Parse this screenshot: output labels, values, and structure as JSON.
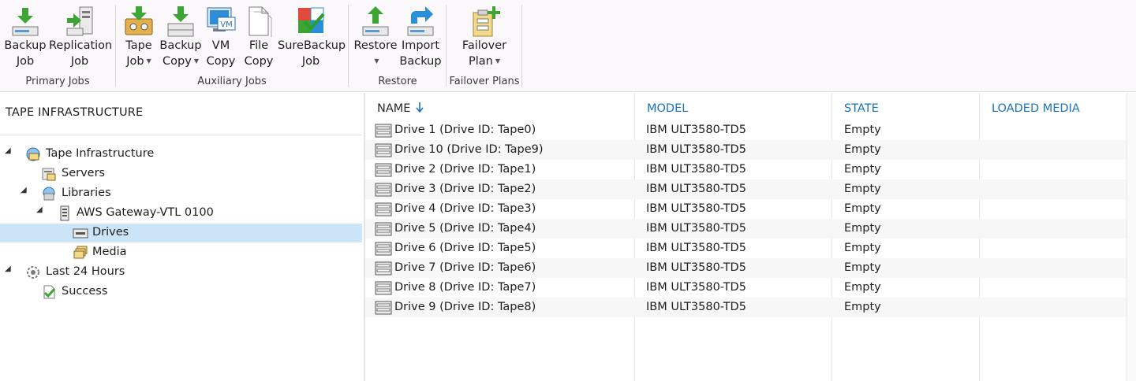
{
  "ribbon": {
    "groups": [
      {
        "caption": "Primary Jobs",
        "buttons": [
          {
            "line1": "Backup",
            "line2": "Job",
            "icon": "backup-job-icon"
          },
          {
            "line1": "Replication",
            "line2": "Job",
            "icon": "replication-job-icon"
          }
        ]
      },
      {
        "caption": "Auxiliary Jobs",
        "buttons": [
          {
            "line1": "Tape",
            "line2": "Job",
            "icon": "tape-job-icon",
            "dropdown": true
          },
          {
            "line1": "Backup",
            "line2": "Copy",
            "icon": "backup-copy-icon",
            "dropdown": true
          },
          {
            "line1": "VM",
            "line2": "Copy",
            "icon": "vm-copy-icon",
            "badge": "VM"
          },
          {
            "line1": "File",
            "line2": "Copy",
            "icon": "file-copy-icon"
          },
          {
            "line1": "SureBackup",
            "line2": "Job",
            "icon": "surebackup-job-icon"
          }
        ]
      },
      {
        "caption": "Restore",
        "buttons": [
          {
            "line1": "Restore",
            "line2": "",
            "icon": "restore-icon",
            "dropdown": true
          },
          {
            "line1": "Import",
            "line2": "Backup",
            "icon": "import-backup-icon"
          }
        ]
      },
      {
        "caption": "Failover Plans",
        "buttons": [
          {
            "line1": "Failover",
            "line2": "Plan",
            "icon": "failover-plan-icon",
            "dropdown": true
          }
        ]
      }
    ]
  },
  "tree": {
    "title": "TAPE INFRASTRUCTURE",
    "nodes": [
      {
        "label": "Tape Infrastructure",
        "icon": "tape-infrastructure-icon",
        "expanded": true
      },
      {
        "label": "Servers",
        "icon": "servers-icon"
      },
      {
        "label": "Libraries",
        "icon": "libraries-icon",
        "expanded": true
      },
      {
        "label": "AWS Gateway-VTL 0100",
        "icon": "tape-library-icon",
        "expanded": true
      },
      {
        "label": "Drives",
        "icon": "drives-icon",
        "selected": true
      },
      {
        "label": "Media",
        "icon": "media-icon"
      },
      {
        "label": "Last 24 Hours",
        "icon": "last-24-hours-icon",
        "expanded": true
      },
      {
        "label": "Success",
        "icon": "success-icon"
      }
    ]
  },
  "grid": {
    "columns": {
      "name": "NAME",
      "model": "MODEL",
      "state": "STATE",
      "loaded_media": "LOADED MEDIA"
    },
    "sort_icon": "sort-descending-icon",
    "rows": [
      {
        "name": "Drive 1 (Drive ID: Tape0)",
        "model": "IBM ULT3580-TD5",
        "state": "Empty",
        "loaded_media": ""
      },
      {
        "name": "Drive 10 (Drive ID: Tape9)",
        "model": "IBM ULT3580-TD5",
        "state": "Empty",
        "loaded_media": ""
      },
      {
        "name": "Drive 2 (Drive ID: Tape1)",
        "model": "IBM ULT3580-TD5",
        "state": "Empty",
        "loaded_media": ""
      },
      {
        "name": "Drive 3 (Drive ID: Tape2)",
        "model": "IBM ULT3580-TD5",
        "state": "Empty",
        "loaded_media": ""
      },
      {
        "name": "Drive 4 (Drive ID: Tape3)",
        "model": "IBM ULT3580-TD5",
        "state": "Empty",
        "loaded_media": ""
      },
      {
        "name": "Drive 5 (Drive ID: Tape4)",
        "model": "IBM ULT3580-TD5",
        "state": "Empty",
        "loaded_media": ""
      },
      {
        "name": "Drive 6 (Drive ID: Tape5)",
        "model": "IBM ULT3580-TD5",
        "state": "Empty",
        "loaded_media": ""
      },
      {
        "name": "Drive 7 (Drive ID: Tape6)",
        "model": "IBM ULT3580-TD5",
        "state": "Empty",
        "loaded_media": ""
      },
      {
        "name": "Drive 8 (Drive ID: Tape7)",
        "model": "IBM ULT3580-TD5",
        "state": "Empty",
        "loaded_media": ""
      },
      {
        "name": "Drive 9 (Drive ID: Tape8)",
        "model": "IBM ULT3580-TD5",
        "state": "Empty",
        "loaded_media": ""
      }
    ]
  },
  "colors": {
    "accent": "#1a73b8",
    "selection": "#cce4f7",
    "green": "#3ea534",
    "blue": "#2b8ed6"
  }
}
